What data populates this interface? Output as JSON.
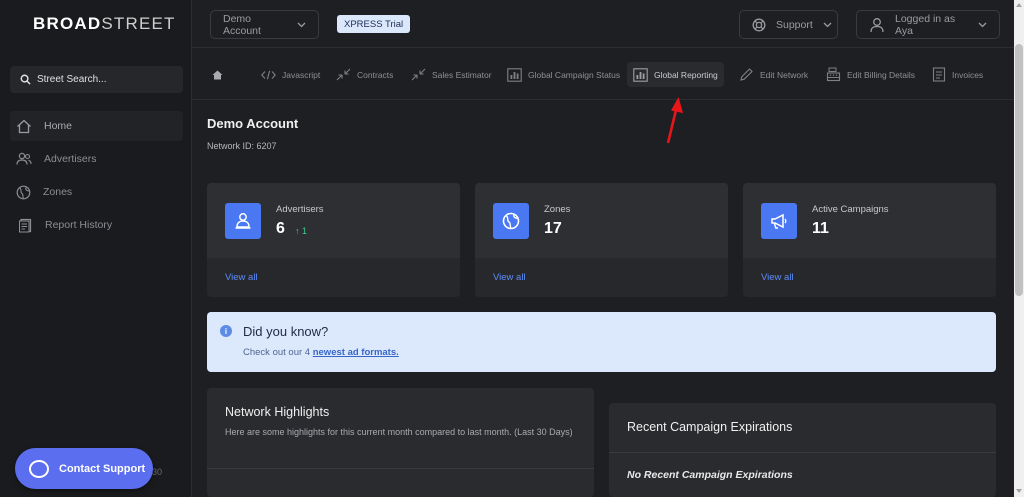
{
  "brand": {
    "bold": "BROAD",
    "light": "STREET"
  },
  "sidebar": {
    "search": {
      "placeholder": "Street Search..."
    },
    "items": [
      {
        "label": "Home",
        "icon": "home-outline-icon"
      },
      {
        "label": "Advertisers",
        "icon": "users-icon"
      },
      {
        "label": "Zones",
        "icon": "globe-icon"
      },
      {
        "label": "Report History",
        "icon": "report-icon"
      }
    ],
    "contact_label": "Contact Support",
    "faint_text": "30"
  },
  "topbar": {
    "account_select": "Demo Account",
    "trial_badge": "XPRESS Trial",
    "support_label": "Support",
    "user_label": "Logged in as Aya"
  },
  "subnav": {
    "items": [
      {
        "label": "Javascript",
        "icon": "code-icon"
      },
      {
        "label": "Contracts",
        "icon": "shrink-icon"
      },
      {
        "label": "Sales Estimator",
        "icon": "shrink-icon"
      },
      {
        "label": "Global Campaign Status",
        "icon": "chart-icon"
      },
      {
        "label": "Global Reporting",
        "icon": "chart-icon",
        "active": true
      },
      {
        "label": "Edit Network",
        "icon": "pencil-icon"
      },
      {
        "label": "Edit Billing Details",
        "icon": "cash-register-icon"
      },
      {
        "label": "Invoices",
        "icon": "invoice-icon"
      }
    ]
  },
  "main": {
    "title": "Demo Account",
    "network_id": "Network ID: 6207",
    "stats": [
      {
        "label": "Advertisers",
        "value": "6",
        "delta": "1",
        "view_all": "View all"
      },
      {
        "label": "Zones",
        "value": "17",
        "view_all": "View all"
      },
      {
        "label": "Active Campaigns",
        "value": "11",
        "view_all": "View all"
      }
    ],
    "info": {
      "title": "Did you know?",
      "text_prefix": "Check out our 4 ",
      "link": "newest ad formats."
    },
    "highlights": {
      "title": "Network Highlights",
      "subtitle": "Here are some highlights for this current month compared to last month. (Last 30 Days)"
    },
    "expirations": {
      "title": "Recent Campaign Expirations",
      "empty": "No Recent Campaign Expirations"
    }
  },
  "colors": {
    "accent": "#4a78f3",
    "link": "#5d8dfa",
    "positive": "#3ccf8e",
    "info_bg": "#dce9fd",
    "contact": "#5b6ef0",
    "annotation": "#e8161b"
  }
}
